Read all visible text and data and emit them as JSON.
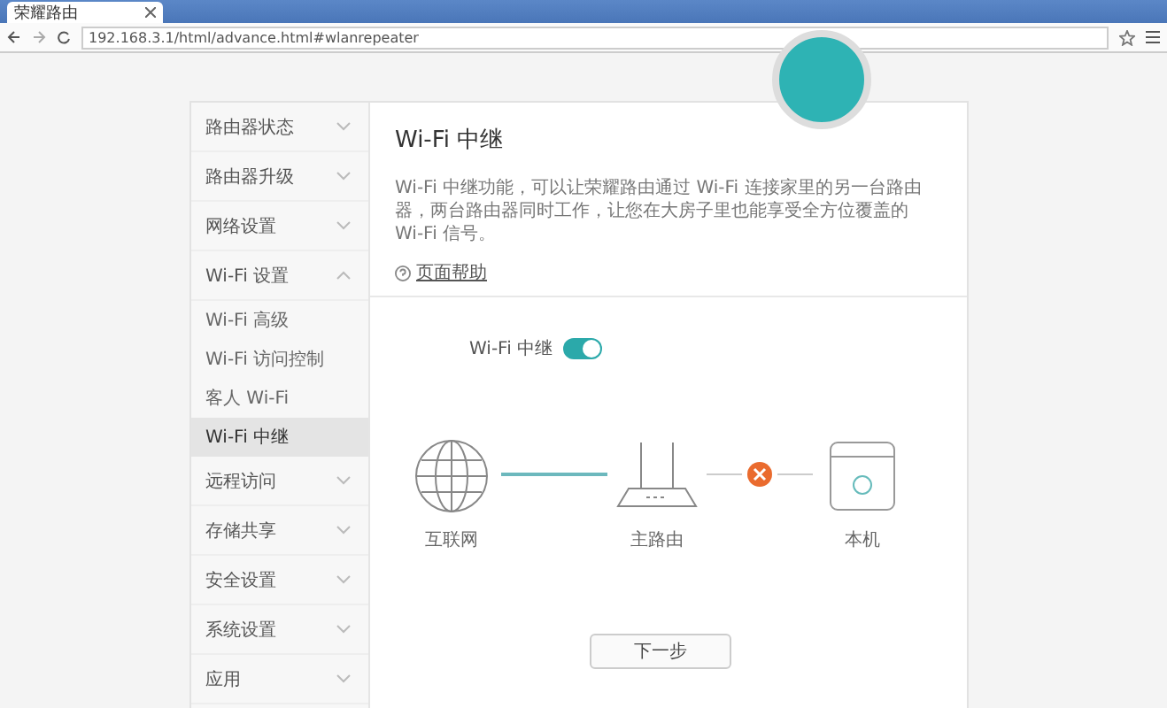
{
  "browser": {
    "tab_title": "荣耀路由",
    "url": "192.168.3.1/html/advance.html#wlanrepeater"
  },
  "sidebar": {
    "items": [
      {
        "label": "路由器状态",
        "expanded": false
      },
      {
        "label": "路由器升级",
        "expanded": false
      },
      {
        "label": "网络设置",
        "expanded": false
      },
      {
        "label": "Wi-Fi 设置",
        "expanded": true,
        "children": [
          {
            "label": "Wi-Fi 高级",
            "selected": false
          },
          {
            "label": "Wi-Fi 访问控制",
            "selected": false
          },
          {
            "label": "客人 Wi-Fi",
            "selected": false
          },
          {
            "label": "Wi-Fi 中继",
            "selected": true
          }
        ]
      },
      {
        "label": "远程访问",
        "expanded": false
      },
      {
        "label": "存储共享",
        "expanded": false
      },
      {
        "label": "安全设置",
        "expanded": false
      },
      {
        "label": "系统设置",
        "expanded": false
      },
      {
        "label": "应用",
        "expanded": false
      }
    ]
  },
  "main": {
    "title": "Wi-Fi 中继",
    "description": "Wi-Fi 中继功能，可以让荣耀路由通过 Wi-Fi 连接家里的另一台路由器，两台路由器同时工作，让您在大房子里也能享受全方位覆盖的 Wi-Fi 信号。",
    "help_link": "页面帮助",
    "toggle": {
      "label": "Wi-Fi 中继",
      "on": true
    },
    "diagram": {
      "nodes": [
        {
          "kind": "globe",
          "label": "互联网"
        },
        {
          "kind": "router",
          "label": "主路由"
        },
        {
          "kind": "box",
          "label": "本机"
        }
      ],
      "links": [
        {
          "connected": true
        },
        {
          "connected": false
        }
      ]
    },
    "next_button": "下一步"
  }
}
